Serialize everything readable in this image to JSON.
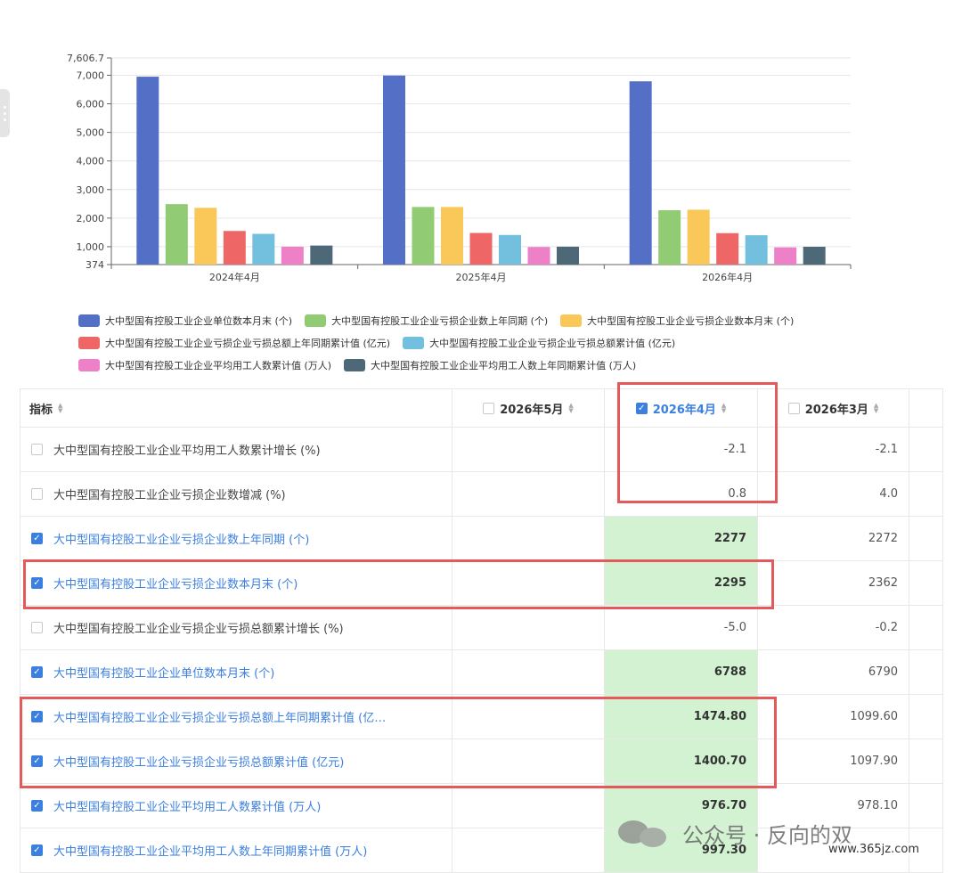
{
  "chart_data": {
    "type": "bar",
    "categories": [
      "2024年4月",
      "2025年4月",
      "2026年4月"
    ],
    "y_ticks": [
      "7,606.7",
      "7,000",
      "6,000",
      "5,000",
      "4,000",
      "3,000",
      "2,000",
      "1,000",
      "374"
    ],
    "ylim": [
      374,
      7606.7
    ],
    "grid": true,
    "legend_position": "bottom",
    "series": [
      {
        "name": "大中型国有控股工业企业单位数本月末 (个)",
        "color": "#5470c6",
        "values": [
          6950,
          6990,
          6788
        ]
      },
      {
        "name": "大中型国有控股工业企业亏损企业数上年同期 (个)",
        "color": "#91cc75",
        "values": [
          2490,
          2390,
          2277
        ]
      },
      {
        "name": "大中型国有控股工业企业亏损企业数本月末 (个)",
        "color": "#fac858",
        "values": [
          2360,
          2390,
          2295
        ]
      },
      {
        "name": "大中型国有控股工业企业亏损企业亏损总额上年同期累计值 (亿元)",
        "color": "#ee6666",
        "values": [
          1550,
          1480,
          1474.8
        ]
      },
      {
        "name": "大中型国有控股工业企业亏损企业亏损总额累计值 (亿元)",
        "color": "#73c0de",
        "values": [
          1450,
          1410,
          1400.7
        ]
      },
      {
        "name": "大中型国有控股工业企业平均用工人数累计值 (万人)",
        "color": "#ee80c8",
        "values": [
          1000,
          990,
          976.7
        ]
      },
      {
        "name": "大中型国有控股工业企业平均用工人数上年同期累计值 (万人)",
        "color": "#4d6978",
        "values": [
          1040,
          1000,
          997.3
        ]
      }
    ]
  },
  "table": {
    "header": {
      "indicator": "指标",
      "may": "2026年5月",
      "apr": "2026年4月",
      "mar": "2026年3月"
    },
    "rows": [
      {
        "name": "大中型国有控股工业企业平均用工人数累计增长 (%)",
        "checked": false,
        "may": "",
        "apr": "-2.1",
        "mar": "-2.1"
      },
      {
        "name": "大中型国有控股工业企业亏损企业数增减 (%)",
        "checked": false,
        "may": "",
        "apr": "0.8",
        "mar": "4.0"
      },
      {
        "name": "大中型国有控股工业企业亏损企业数上年同期 (个)",
        "checked": true,
        "may": "",
        "apr": "2277",
        "mar": "2272"
      },
      {
        "name": "大中型国有控股工业企业亏损企业数本月末 (个)",
        "checked": true,
        "may": "",
        "apr": "2295",
        "mar": "2362"
      },
      {
        "name": "大中型国有控股工业企业亏损企业亏损总额累计增长 (%)",
        "checked": false,
        "may": "",
        "apr": "-5.0",
        "mar": "-0.2"
      },
      {
        "name": "大中型国有控股工业企业单位数本月末 (个)",
        "checked": true,
        "may": "",
        "apr": "6788",
        "mar": "6790"
      },
      {
        "name": "大中型国有控股工业企业亏损企业亏损总额上年同期累计值 (亿…",
        "checked": true,
        "may": "",
        "apr": "1474.80",
        "mar": "1099.60"
      },
      {
        "name": "大中型国有控股工业企业亏损企业亏损总额累计值 (亿元)",
        "checked": true,
        "may": "",
        "apr": "1400.70",
        "mar": "1097.90"
      },
      {
        "name": "大中型国有控股工业企业平均用工人数累计值 (万人)",
        "checked": true,
        "may": "",
        "apr": "976.70",
        "mar": "978.10"
      },
      {
        "name": "大中型国有控股工业企业平均用工人数上年同期累计值 (万人)",
        "checked": true,
        "may": "",
        "apr": "997.30",
        "mar": ""
      }
    ]
  },
  "watermark": {
    "text": "公众号 · 反向的双",
    "url": "www.365jz.com"
  }
}
